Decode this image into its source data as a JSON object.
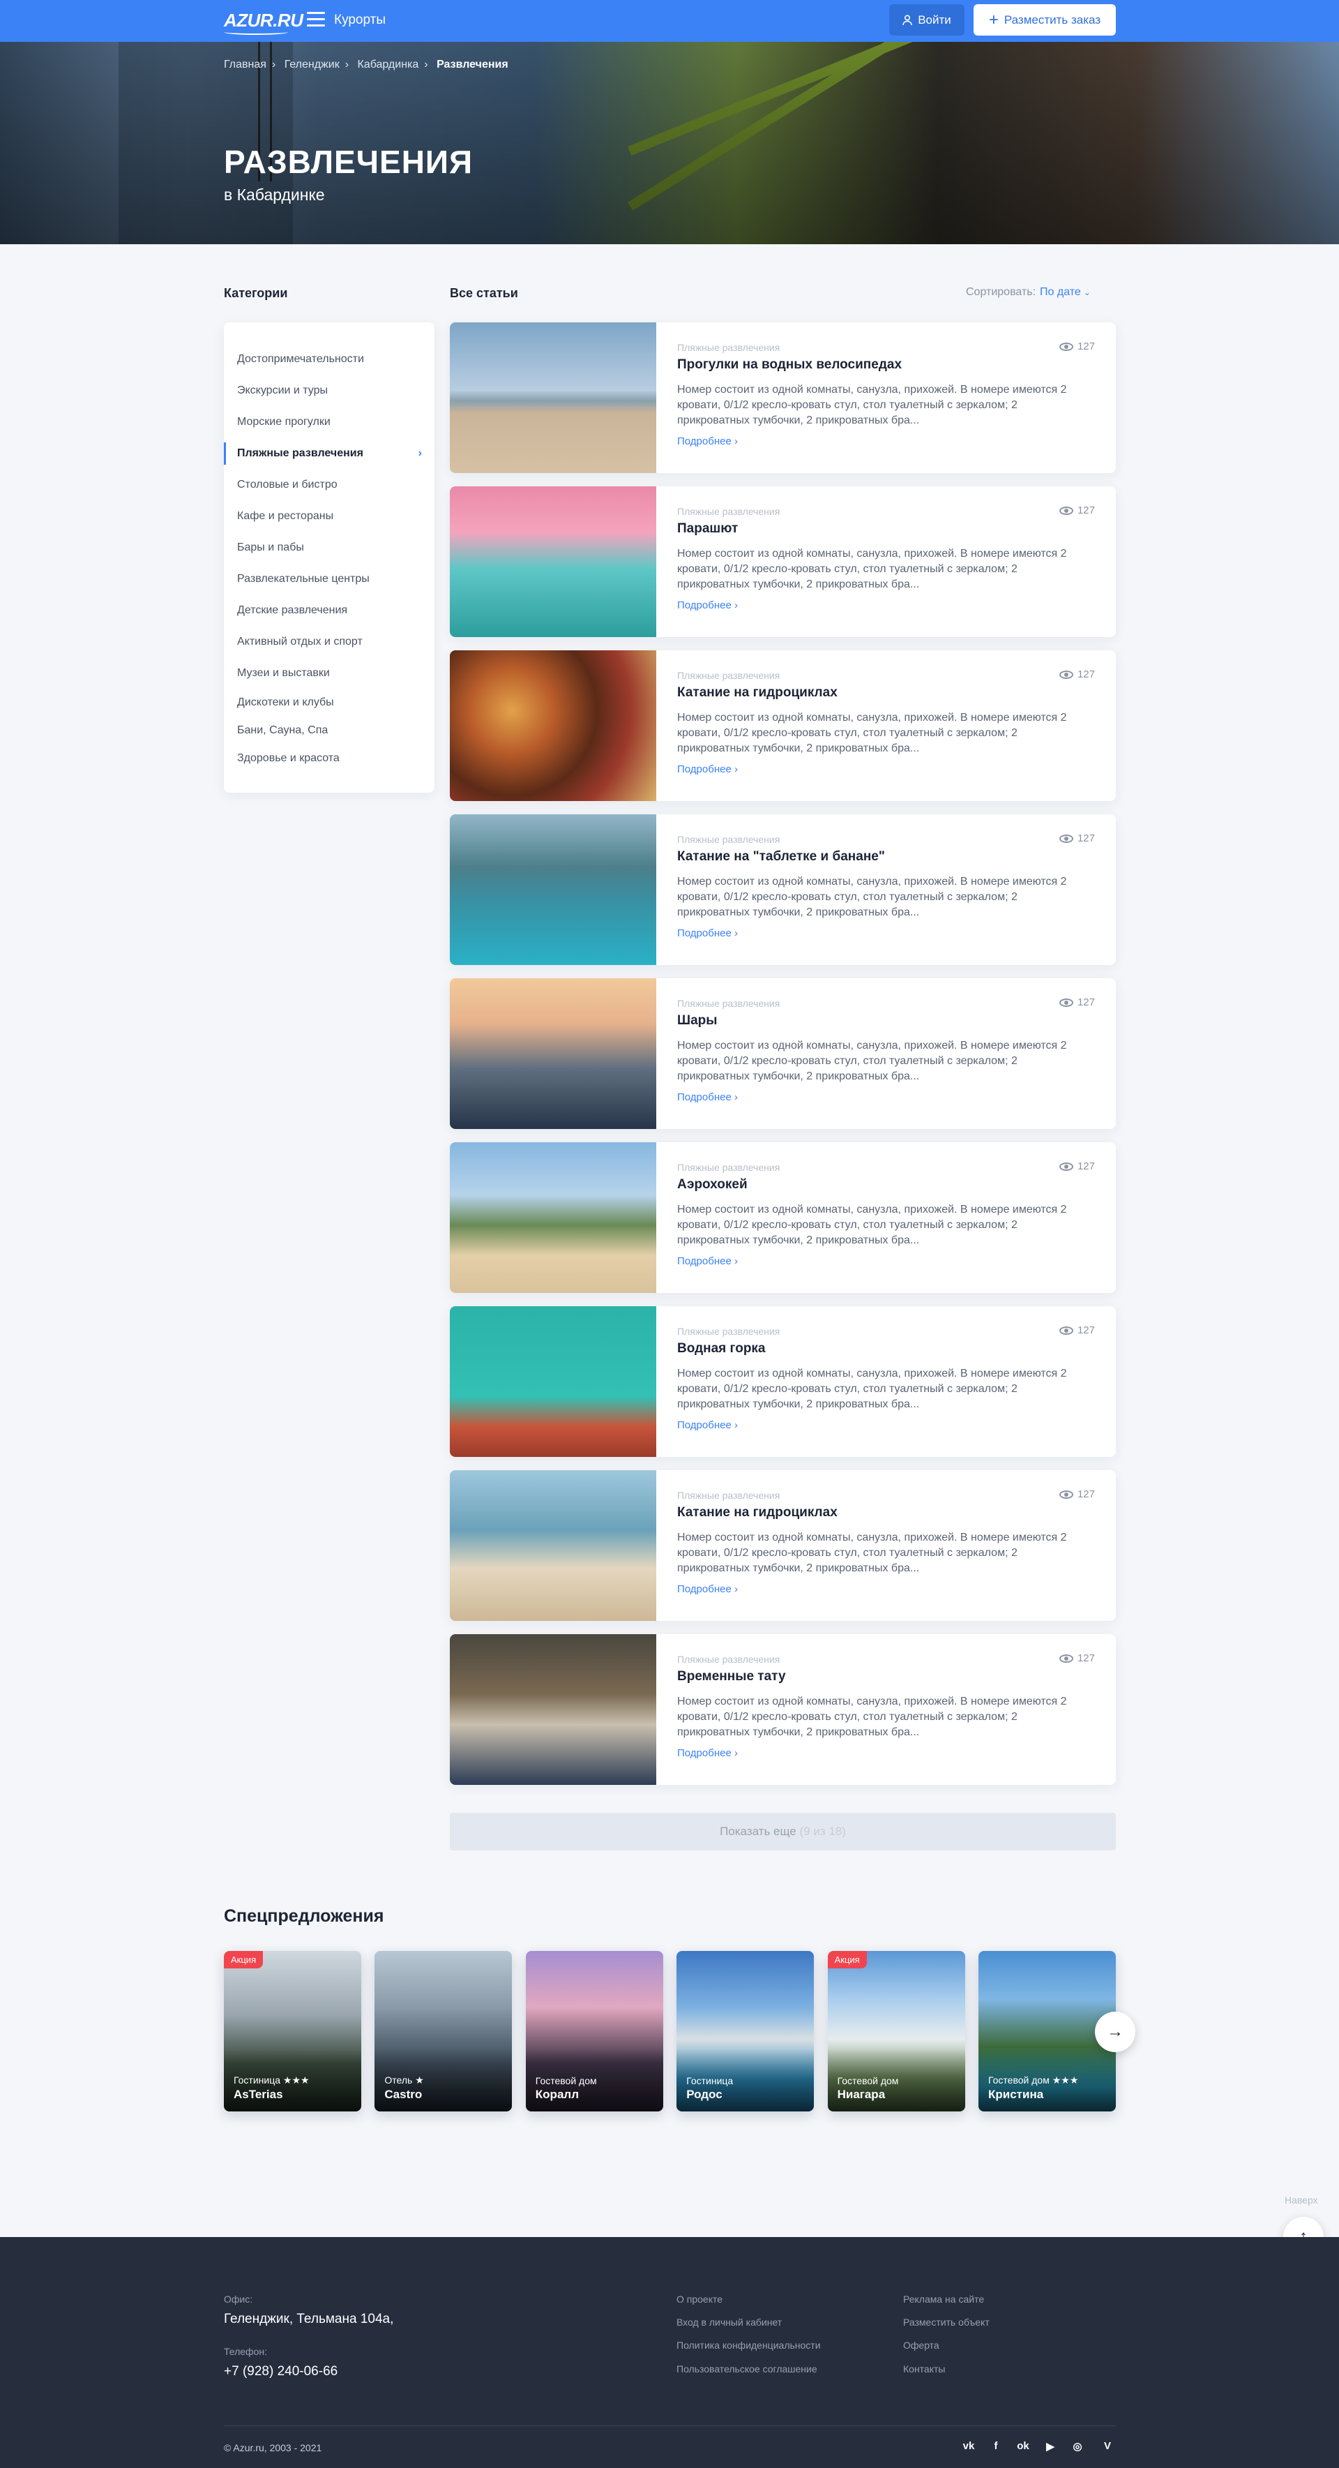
{
  "header": {
    "logo": "AZUR.RU",
    "resorts_label": "Курорты",
    "login_label": "Войти",
    "order_label": "Разместить заказ"
  },
  "breadcrumbs": [
    "Главная",
    "Геленджик",
    "Кабардинка",
    "Развлечения"
  ],
  "hero": {
    "title": "РАЗВЛЕЧЕНИЯ",
    "subtitle": "в Кабардинке"
  },
  "sidebar": {
    "title": "Категории",
    "items": [
      "Достопримечательности",
      "Экскурсии и туры",
      "Морские прогулки",
      "Пляжные развлечения",
      "Столовые и бистро",
      "Кафе и рестораны",
      "Бары и пабы",
      "Развлекательные центры",
      "Детские развлечения",
      "Активный отдых и спорт",
      "Музеи и выставки",
      "Дискотеки и клубы",
      "Бани, Сауна, Спа",
      "Здоровье и красота"
    ],
    "active_index": 3
  },
  "articles_header": {
    "title": "Все статьи",
    "sort_label": "Сортировать:",
    "sort_value": "По дате"
  },
  "articles": [
    {
      "category": "Пляжные развлечения",
      "views": "127",
      "title": "Прогулки на водных велосипедах",
      "desc": "Номер состоит из одной комнаты, санузла, прихожей. В номере имеются 2 кровати, 0/1/2 кресло-кровать стул, стол туалетный с зеркалом; 2 прикроватных тумбочки, 2 прикроватных бра...",
      "more": "Подробнее"
    },
    {
      "category": "Пляжные развлечения",
      "views": "127",
      "title": "Парашют",
      "desc": "Номер состоит из одной комнаты, санузла, прихожей. В номере имеются 2 кровати, 0/1/2 кресло-кровать стул, стол туалетный с зеркалом; 2 прикроватных тумбочки, 2 прикроватных бра...",
      "more": "Подробнее"
    },
    {
      "category": "Пляжные развлечения",
      "views": "127",
      "title": "Катание на гидроциклах",
      "desc": "Номер состоит из одной комнаты, санузла, прихожей. В номере имеются 2 кровати, 0/1/2 кресло-кровать стул, стол туалетный с зеркалом; 2 прикроватных тумбочки, 2 прикроватных бра...",
      "more": "Подробнее"
    },
    {
      "category": "Пляжные развлечения",
      "views": "127",
      "title": "Катание на \"таблетке и банане\"",
      "desc": "Номер состоит из одной комнаты, санузла, прихожей. В номере имеются 2 кровати, 0/1/2 кресло-кровать стул, стол туалетный с зеркалом; 2 прикроватных тумбочки, 2 прикроватных бра...",
      "more": "Подробнее"
    },
    {
      "category": "Пляжные развлечения",
      "views": "127",
      "title": "Шары",
      "desc": "Номер состоит из одной комнаты, санузла, прихожей. В номере имеются 2 кровати, 0/1/2 кресло-кровать стул, стол туалетный с зеркалом; 2 прикроватных тумбочки, 2 прикроватных бра...",
      "more": "Подробнее"
    },
    {
      "category": "Пляжные развлечения",
      "views": "127",
      "title": "Аэрохокей",
      "desc": "Номер состоит из одной комнаты, санузла, прихожей. В номере имеются 2 кровати, 0/1/2 кресло-кровать стул, стол туалетный с зеркалом; 2 прикроватных тумбочки, 2 прикроватных бра...",
      "more": "Подробнее"
    },
    {
      "category": "Пляжные развлечения",
      "views": "127",
      "title": "Водная горка",
      "desc": "Номер состоит из одной комнаты, санузла, прихожей. В номере имеются 2 кровати, 0/1/2 кресло-кровать стул, стол туалетный с зеркалом; 2 прикроватных тумбочки, 2 прикроватных бра...",
      "more": "Подробнее"
    },
    {
      "category": "Пляжные развлечения",
      "views": "127",
      "title": "Катание на гидроциклах",
      "desc": "Номер состоит из одной комнаты, санузла, прихожей. В номере имеются 2 кровати, 0/1/2 кресло-кровать стул, стол туалетный с зеркалом; 2 прикроватных тумбочки, 2 прикроватных бра...",
      "more": "Подробнее"
    },
    {
      "category": "Пляжные развлечения",
      "views": "127",
      "title": "Временные тату",
      "desc": "Номер состоит из одной комнаты, санузла, прихожей. В номере имеются 2 кровати, 0/1/2 кресло-кровать стул, стол туалетный с зеркалом; 2 прикроватных тумбочки, 2 прикроватных бра...",
      "more": "Подробнее"
    }
  ],
  "load_more": {
    "label": "Показать еще",
    "count": "(9 из 18)"
  },
  "specials": {
    "title": "Спецпредложения",
    "items": [
      {
        "badge": "Акция",
        "type": "Гостиница ★★★",
        "name": "AsTerias"
      },
      {
        "badge": "",
        "type": "Отель ★",
        "name": "Castro"
      },
      {
        "badge": "",
        "type": "Гостевой дом",
        "name": "Коралл"
      },
      {
        "badge": "",
        "type": "Гостиница",
        "name": "Родос"
      },
      {
        "badge": "Акция",
        "type": "Гостевой дом",
        "name": "Ниагара"
      },
      {
        "badge": "",
        "type": "Гостевой дом ★★★",
        "name": "Кристина"
      }
    ]
  },
  "scroll_top_label": "Наверх",
  "footer": {
    "office_label": "Офис:",
    "office_value": "Геленджик, Тельмана 104а,",
    "phone_label": "Телефон:",
    "phone_value": "+7 (928) 240-06-66",
    "links_col1": [
      "О проекте",
      "Вход в личный кабинет",
      "Политика конфиденциальности",
      "Пользовательское соглашение"
    ],
    "links_col2": [
      "Реклама на сайте",
      "Разместить объект",
      "Оферта",
      "Контакты"
    ],
    "copyright": "© Azur.ru, 2003 - 2021",
    "social": [
      "vk",
      "f",
      "ok",
      "▶",
      "◎",
      "V"
    ]
  },
  "colors": {
    "accent": "#3b82f6",
    "footer_bg": "#262e3e",
    "badge": "#f0454e",
    "page_bg": "#f4f6f9"
  }
}
